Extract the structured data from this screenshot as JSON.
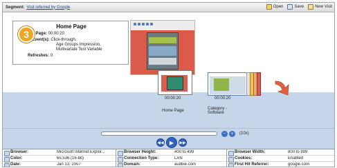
{
  "topbar": {
    "segment_label": "Segment:",
    "segment_value": "Visit referred by Google",
    "actions": [
      {
        "label": "Open",
        "icon": "folder-icon"
      },
      {
        "label": "Save",
        "icon": "save-icon"
      },
      {
        "label": "New Visit",
        "icon": "new-visit-icon"
      }
    ]
  },
  "badge": "3",
  "card": {
    "title": "Home Page",
    "time_label": "Time on Page:",
    "time_value": "00:00:20",
    "events_label": "Event(s):",
    "events_lines": [
      "Click-through,",
      "Age Groups Impression,",
      "Multivariate Test Variable"
    ],
    "refreshes_label": "Refreshes:",
    "refreshes_value": "0"
  },
  "timeline": {
    "items": [
      {
        "time": "00:00:20",
        "label": "Home Page"
      },
      {
        "time": "00:00:20",
        "label": "Category - Software"
      }
    ]
  },
  "controls": {
    "zoom_label": "(10x)",
    "zoom_out": "−",
    "zoom_in": "+",
    "prev": "◀◀",
    "play": "▶",
    "next": "▶▶"
  },
  "properties": [
    [
      {
        "key": "Browser:",
        "value": "Microsoft Internet Explor..."
      },
      {
        "key": "Color:",
        "value": "65,536 (16-bit)"
      },
      {
        "key": "Date:",
        "value": "Jan 13, 2007"
      }
    ],
    [
      {
        "key": "Browser Height:",
        "value": "400 to 499"
      },
      {
        "key": "Connection Type:",
        "value": "LAN"
      },
      {
        "key": "Domain:",
        "value": "audbie.com"
      }
    ],
    [
      {
        "key": "Browser Width:",
        "value": "800 to 899"
      },
      {
        "key": "Cookies:",
        "value": "Enabled"
      },
      {
        "key": "First Hit Referrer:",
        "value": "google.com"
      }
    ]
  ]
}
